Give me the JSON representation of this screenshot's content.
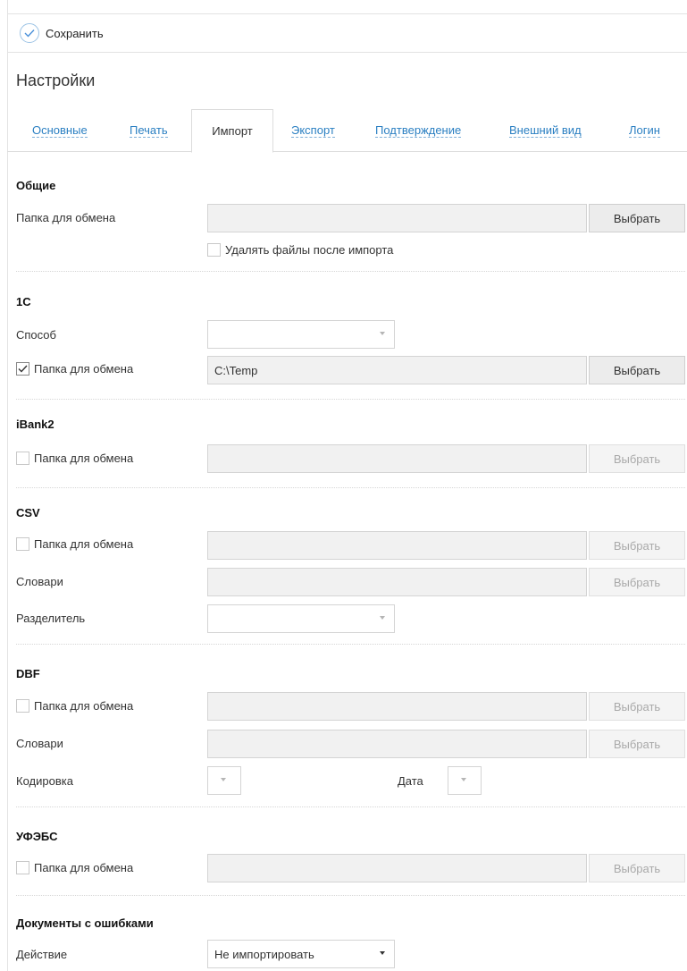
{
  "toolbar": {
    "save_label": "Сохранить"
  },
  "page": {
    "title": "Настройки"
  },
  "tabs": [
    {
      "label": "Основные"
    },
    {
      "label": "Печать"
    },
    {
      "label": "Импорт"
    },
    {
      "label": "Экспорт"
    },
    {
      "label": "Подтверждение"
    },
    {
      "label": "Внешний вид"
    },
    {
      "label": "Логин"
    }
  ],
  "general": {
    "title": "Общие",
    "folder_label": "Папка для обмена",
    "folder_value": "",
    "choose_label": "Выбрать",
    "delete_files_label": "Удалять файлы после импорта",
    "delete_files_checked": false
  },
  "onec": {
    "title": "1С",
    "method_label": "Способ",
    "method_value": "",
    "folder_label": "Папка для обмена",
    "folder_checked": true,
    "folder_value": "C:\\Temp",
    "choose_label": "Выбрать"
  },
  "ibank": {
    "title": "iBank2",
    "folder_label": "Папка для обмена",
    "folder_checked": false,
    "folder_value": "",
    "choose_label": "Выбрать"
  },
  "csv": {
    "title": "CSV",
    "folder_label": "Папка для обмена",
    "folder_checked": false,
    "folder_value": "",
    "choose_label": "Выбрать",
    "dict_label": "Словари",
    "dict_value": "",
    "dict_choose_label": "Выбрать",
    "separator_label": "Разделитель",
    "separator_value": ""
  },
  "dbf": {
    "title": "DBF",
    "folder_label": "Папка для обмена",
    "folder_checked": false,
    "folder_value": "",
    "choose_label": "Выбрать",
    "dict_label": "Словари",
    "dict_value": "",
    "dict_choose_label": "Выбрать",
    "encoding_label": "Кодировка",
    "encoding_value": "",
    "date_label": "Дата",
    "date_value": ""
  },
  "ufebs": {
    "title": "УФЭБС",
    "folder_label": "Папка для обмена",
    "folder_checked": false,
    "folder_value": "",
    "choose_label": "Выбрать"
  },
  "errors": {
    "title": "Документы с ошибками",
    "action_label": "Действие",
    "action_value": "Не импортировать"
  },
  "colors": {
    "link": "#2a7fc2",
    "check_accent": "#4a90d9",
    "disabled_text": "#a9a9a9"
  }
}
